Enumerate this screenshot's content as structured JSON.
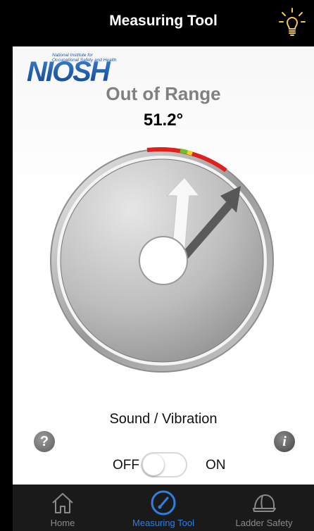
{
  "navbar": {
    "title": "Measuring Tool",
    "light_icon": "lightbulb-icon"
  },
  "logo": {
    "line1": "National Institute for",
    "line2": "Occupational Safety and Health",
    "wordmark": "NIOSH"
  },
  "measurement": {
    "status": "Out of Range",
    "angle": "51.2°"
  },
  "sound": {
    "label": "Sound / Vibration",
    "off_label": "OFF",
    "on_label": "ON",
    "enabled": false
  },
  "help_icon": "question-mark-icon",
  "info_icon": "info-icon",
  "tabs": [
    {
      "label": "Home",
      "icon": "house-icon",
      "active": false
    },
    {
      "label": "Measuring Tool",
      "icon": "gauge-icon",
      "active": true
    },
    {
      "label": "Ladder Safety",
      "icon": "hard-hat-icon",
      "active": false
    }
  ],
  "colors": {
    "accent": "#2f7fe0",
    "range_red": "#e0201a",
    "range_green": "#6cc02a",
    "range_yellow": "#f2d31b",
    "logo_blue": "#1c5aa6"
  }
}
